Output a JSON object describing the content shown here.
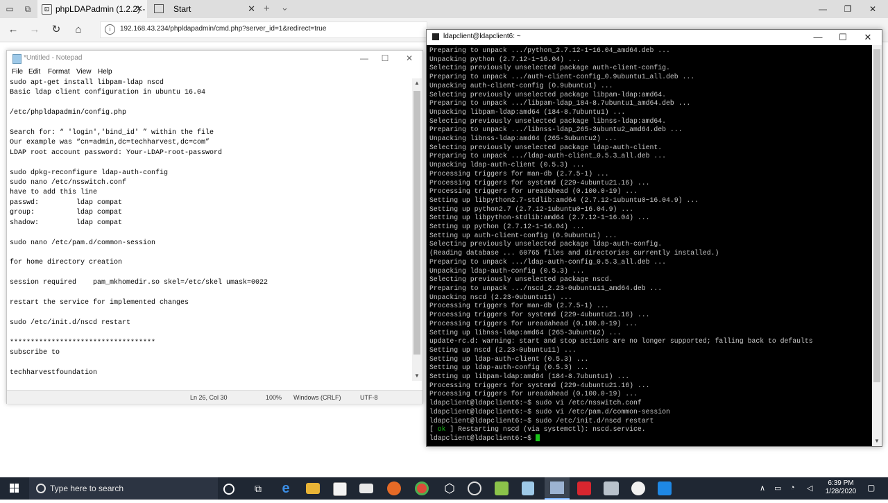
{
  "browser": {
    "active_tab": "phpLDAPadmin (1.2.2) -",
    "other_tab": "Start",
    "new_tab": "+",
    "tabs_menu": "⌄",
    "url": "192.168.43.234/phpldapadmin/cmd.php?server_id=1&redirect=true",
    "minimize": "—",
    "restore": "❐",
    "close": "✕"
  },
  "notepad": {
    "title": "*Untitled - Notepad",
    "menu": [
      "File",
      "Edit",
      "Format",
      "View",
      "Help"
    ],
    "text": "sudo apt-get install libpam-ldap nscd\nBasic ldap client configuration in ubuntu 16.04\n\n/etc/phpldapadmin/config.php\n\nSearch for: “ 'login','bind_id' ” within the file\nOur example was “cn=admin,dc=techharvest,dc=com”\nLDAP root account password: Your-LDAP-root-password\n\nsudo dpkg-reconfigure ldap-auth-config\nsudo nano /etc/nsswitch.conf\nhave to add this line\npasswd:         ldap compat\ngroup:          ldap compat\nshadow:         ldap compat\n\nsudo nano /etc/pam.d/common-session\n\nfor home directory creation\n\nsession required    pam_mkhomedir.so skel=/etc/skel umask=0022\n\nrestart the service for implemented changes\n\nsudo /etc/init.d/nscd restart\n\n***********************************\nsubscribe to\n\ntechharvestfoundation\n",
    "status": {
      "position": "Ln 26, Col 30",
      "zoom": "100%",
      "line_ending": "Windows (CRLF)",
      "encoding": "UTF-8"
    }
  },
  "terminal": {
    "title": "ldapclient@ldapclient6: ~",
    "text_before_ok": "Preparing to unpack .../python_2.7.12-1~16.04_amd64.deb ...\nUnpacking python (2.7.12-1~16.04) ...\nSelecting previously unselected package auth-client-config.\nPreparing to unpack .../auth-client-config_0.9ubuntu1_all.deb ...\nUnpacking auth-client-config (0.9ubuntu1) ...\nSelecting previously unselected package libpam-ldap:amd64.\nPreparing to unpack .../libpam-ldap_184-8.7ubuntu1_amd64.deb ...\nUnpacking libpam-ldap:amd64 (184-8.7ubuntu1) ...\nSelecting previously unselected package libnss-ldap:amd64.\nPreparing to unpack .../libnss-ldap_265-3ubuntu2_amd64.deb ...\nUnpacking libnss-ldap:amd64 (265-3ubuntu2) ...\nSelecting previously unselected package ldap-auth-client.\nPreparing to unpack .../ldap-auth-client_0.5.3_all.deb ...\nUnpacking ldap-auth-client (0.5.3) ...\nProcessing triggers for man-db (2.7.5-1) ...\nProcessing triggers for systemd (229-4ubuntu21.16) ...\nProcessing triggers for ureadahead (0.100.0-19) ...\nSetting up libpython2.7-stdlib:amd64 (2.7.12-1ubuntu0~16.04.9) ...\nSetting up python2.7 (2.7.12-1ubuntu0~16.04.9) ...\nSetting up libpython-stdlib:amd64 (2.7.12-1~16.04) ...\nSetting up python (2.7.12-1~16.04) ...\nSetting up auth-client-config (0.9ubuntu1) ...\nSelecting previously unselected package ldap-auth-config.\n(Reading database ... 60765 files and directories currently installed.)\nPreparing to unpack .../ldap-auth-config_0.5.3_all.deb ...\nUnpacking ldap-auth-config (0.5.3) ...\nSelecting previously unselected package nscd.\nPreparing to unpack .../nscd_2.23-0ubuntu11_amd64.deb ...\nUnpacking nscd (2.23-0ubuntu11) ...\nProcessing triggers for man-db (2.7.5-1) ...\nProcessing triggers for systemd (229-4ubuntu21.16) ...\nProcessing triggers for ureadahead (0.100.0-19) ...\nSetting up libnss-ldap:amd64 (265-3ubuntu2) ...\nupdate-rc.d: warning: start and stop actions are no longer supported; falling back to defaults\nSetting up nscd (2.23-0ubuntu11) ...\nSetting up ldap-auth-client (0.5.3) ...\nSetting up ldap-auth-config (0.5.3) ...\nSetting up libpam-ldap:amd64 (184-8.7ubuntu1) ...\nProcessing triggers for systemd (229-4ubuntu21.16) ...\nProcessing triggers for ureadahead (0.100.0-19) ...\nldapclient@ldapclient6:~$ sudo vi /etc/nsswitch.conf\nldapclient@ldapclient6:~$ sudo vi /etc/pam.d/common-session\nldapclient@ldapclient6:~$ sudo /etc/init.d/nscd restart\n[ ",
    "ok": "ok",
    "ok_rest": " ] Restarting nscd (via systemctl): nscd.service.\n",
    "prompt": "ldapclient@ldapclient6:~$ "
  },
  "taskbar": {
    "search_placeholder": "Type here to search",
    "time": "6:39 PM",
    "date": "1/28/2020",
    "icons": [
      "cortana-icon",
      "task-view-icon",
      "edge-icon",
      "file-explorer-icon",
      "store-icon",
      "mail-icon",
      "firefox-icon",
      "chrome-icon",
      "3d-viewer-icon",
      "app-icon",
      "notepadpp-icon",
      "notepad-icon",
      "putty-icon",
      "adobe-icon",
      "network-app-icon",
      "app2-icon",
      "app3-icon"
    ]
  }
}
